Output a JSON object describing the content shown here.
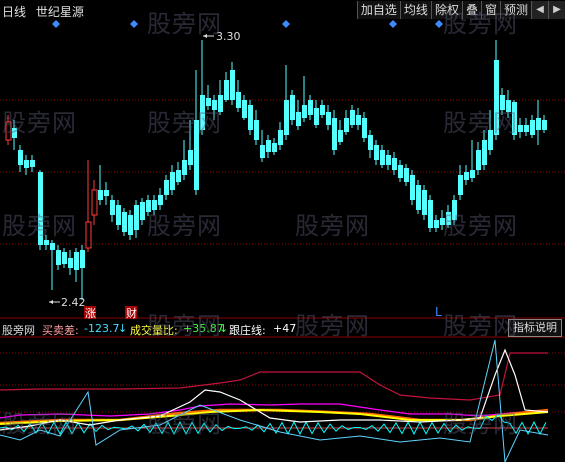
{
  "header": {
    "period": "日线",
    "stock_name": "世纪星源"
  },
  "toolbar": {
    "buttons": [
      "加自选",
      "均线",
      "除权",
      "叠",
      "窗",
      "预测"
    ],
    "nav": [
      "◀",
      "▶"
    ]
  },
  "chart": {
    "high_label": "3.30",
    "low_label": "2.42",
    "marker_zhang": "涨",
    "marker_cai": "财",
    "marker_l": "L"
  },
  "indicator": {
    "name": "股旁网",
    "buy_sell_label": "买卖差:",
    "buy_sell_value": "-123.7",
    "buy_sell_arrow": "↓",
    "volume_ratio_label": "成交量比:",
    "volume_ratio_value": "+35.87",
    "volume_ratio_arrow": "↓",
    "follow_label": "跟庄线:",
    "follow_value": "+47",
    "help_button": "指标说明"
  },
  "watermark": "股旁网",
  "colors": {
    "up": "#ff3c3c",
    "down": "#54ffff",
    "grid": "#8b0000",
    "diamond": "#3c8cff",
    "white_line": "#ffffff",
    "yellow_line": "#ffff00",
    "magenta_line": "#ff00ff",
    "cyan_line": "#00ffff"
  }
}
